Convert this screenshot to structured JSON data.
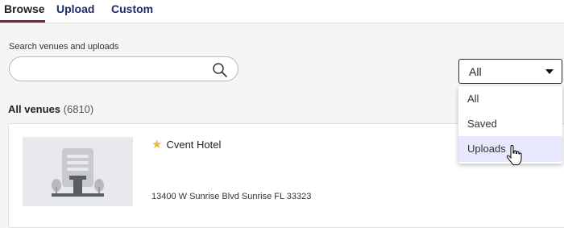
{
  "tabs": [
    {
      "label": "Browse",
      "active": true
    },
    {
      "label": "Upload",
      "active": false
    },
    {
      "label": "Custom",
      "active": false
    }
  ],
  "search": {
    "label": "Search venues and uploads",
    "value": "",
    "placeholder": ""
  },
  "filter": {
    "selected": "All",
    "options": [
      "All",
      "Saved",
      "Uploads"
    ],
    "hovered": "Uploads"
  },
  "section": {
    "title": "All venues",
    "count": "(6810)"
  },
  "venues": [
    {
      "name": "Cvent Hotel",
      "address": "13400 W Sunrise Blvd Sunrise FL 33323",
      "saved": true
    }
  ],
  "colors": {
    "tab_active_underline": "#7b1b4a",
    "tab_inactive": "#1f2a6b",
    "star": "#e8b84a",
    "option_hover": "#e5e9fb",
    "select_border": "#1f2a6b"
  },
  "icons": [
    "search-icon",
    "chevron-down-icon",
    "star-icon",
    "building-placeholder-icon",
    "hand-cursor-icon"
  ]
}
